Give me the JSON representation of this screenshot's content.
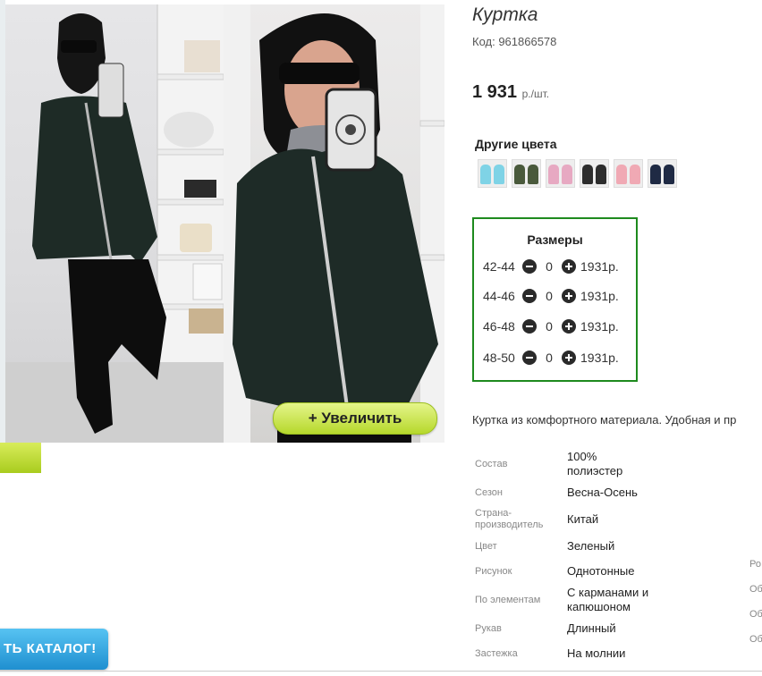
{
  "product": {
    "title": "Куртка",
    "code": "Код: 961866578",
    "price": "1 931",
    "price_unit": "р./шт."
  },
  "colors": {
    "title": "Другие цвета",
    "swatches": [
      "#7fd3e6",
      "#4a5a3c",
      "#e7a9c2",
      "#2d2d2d",
      "#f0a9b4",
      "#1f2a44"
    ]
  },
  "sizes": {
    "title": "Размеры",
    "rows": [
      {
        "label": "42-44",
        "qty": "0",
        "price": "1931р."
      },
      {
        "label": "44-46",
        "qty": "0",
        "price": "1931р."
      },
      {
        "label": "46-48",
        "qty": "0",
        "price": "1931р."
      },
      {
        "label": "48-50",
        "qty": "0",
        "price": "1931р."
      }
    ]
  },
  "gallery": {
    "zoom_label": "+  Увеличить"
  },
  "description": "Куртка из комфортного материала. Удобная и пр",
  "specs": [
    {
      "label": "Состав",
      "value": "100% полиэстер"
    },
    {
      "label": "Сезон",
      "value": "Весна-Осень"
    },
    {
      "label": "Страна-производитель",
      "value": "Китай"
    },
    {
      "label": "Цвет",
      "value": "Зеленый"
    },
    {
      "label": "Рисунок",
      "value": "Однотонные"
    },
    {
      "label": "По элементам",
      "value": "С карманами и капюшоном"
    },
    {
      "label": "Рукав",
      "value": "Длинный"
    },
    {
      "label": "Застежка",
      "value": "На молнии"
    }
  ],
  "edge_labels": [
    "Ро",
    "Об",
    "Об",
    "Об"
  ],
  "catalog_button": "ТЬ КАТАЛОГ!"
}
